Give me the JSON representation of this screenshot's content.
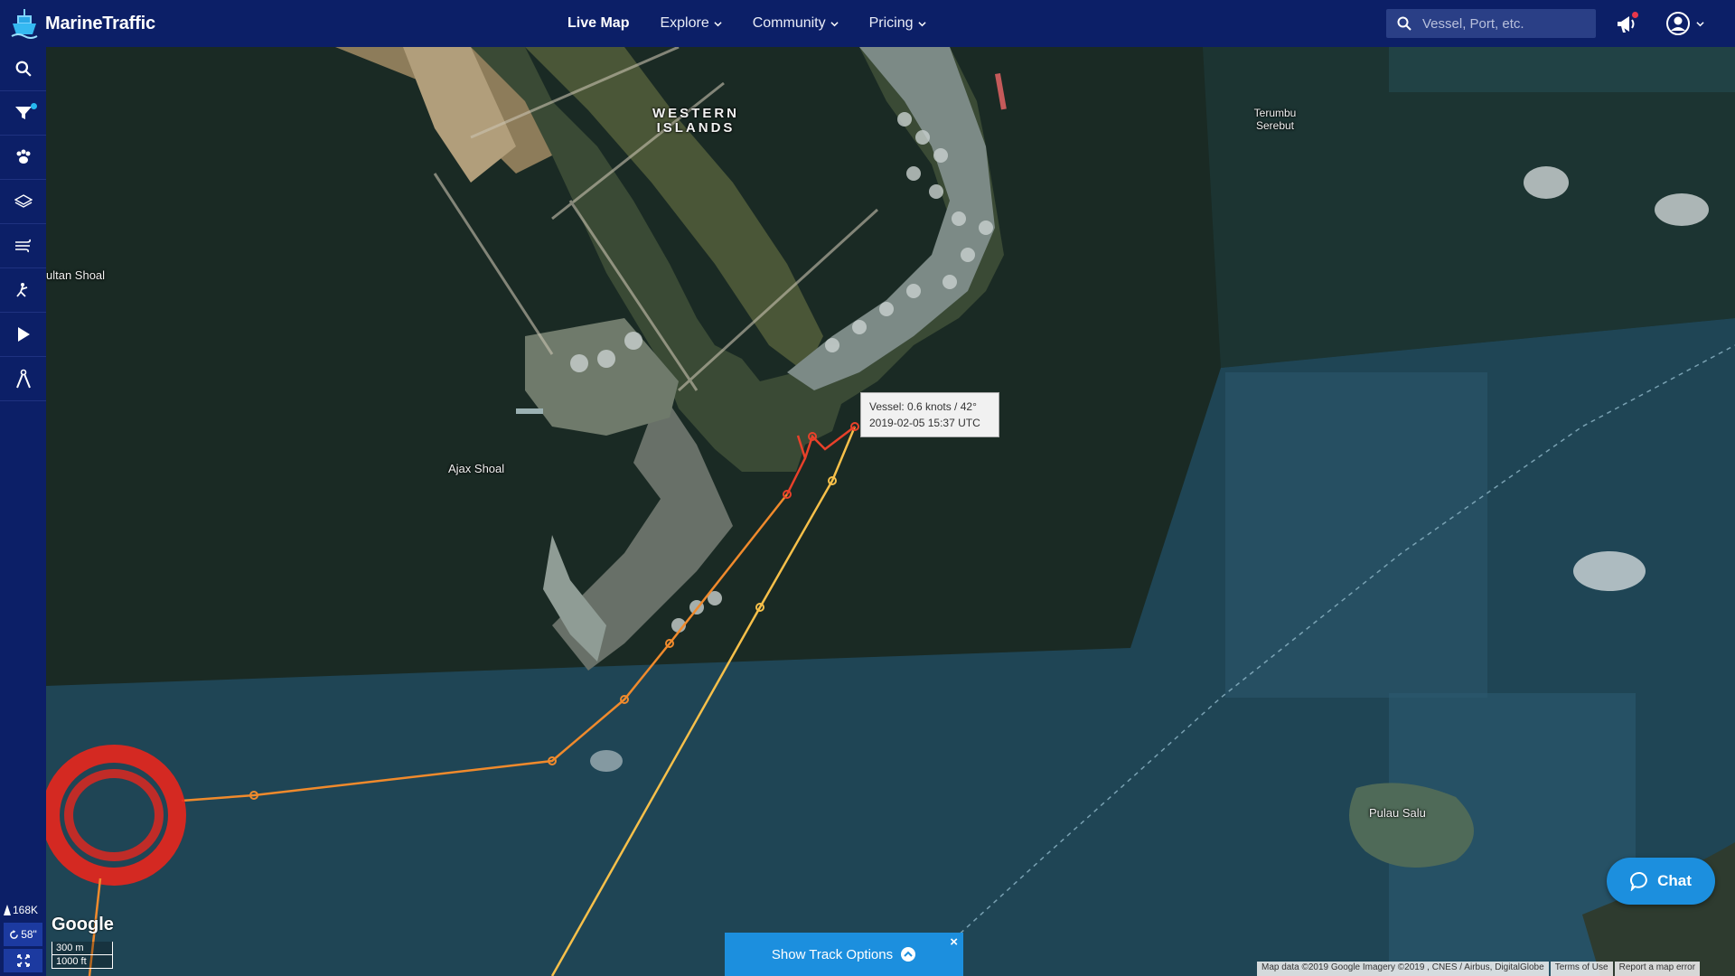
{
  "app": {
    "title": "MarineTraffic"
  },
  "nav": [
    {
      "label": "Live Map",
      "dropdown": false,
      "active": true
    },
    {
      "label": "Explore",
      "dropdown": true
    },
    {
      "label": "Community",
      "dropdown": true
    },
    {
      "label": "Pricing",
      "dropdown": true
    }
  ],
  "search": {
    "placeholder": "Vessel, Port, etc."
  },
  "sidebar": {
    "tools": [
      "search-icon",
      "filter-icon",
      "paw-icon",
      "layers-icon",
      "wind-icon",
      "measure-icon",
      "play-icon",
      "compass-icon"
    ],
    "stats": {
      "vessels": "168K",
      "refresh": "58\""
    }
  },
  "map": {
    "labels": {
      "western_islands": "WESTERN ISLANDS",
      "terumbu_serebut": "Terumbu Serebut",
      "sultan_shoal": "ultan Shoal",
      "ajax_shoal": "Ajax Shoal",
      "pulau_salu": "Pulau Salu"
    },
    "tooltip": {
      "line1": "Vessel: 0.6 knots / 42°",
      "line2": "2019-02-05 15:37 UTC"
    },
    "scale": {
      "metric": "300 m",
      "imperial": "1000 ft"
    },
    "google_logo": "Google",
    "attribution": {
      "data": "Map data ©2019 Google Imagery ©2019 , CNES / Airbus, DigitalGlobe",
      "terms": "Terms of Use",
      "report": "Report a map error"
    }
  },
  "track_options": {
    "label": "Show Track Options",
    "close": "×"
  },
  "chat": {
    "label": "Chat"
  },
  "colors": {
    "nav_bg": "#0c1f67",
    "accent": "#1c8fde",
    "track_red": "#e8412a",
    "track_orange": "#f08a2c",
    "track_yellow": "#f7c04a"
  }
}
